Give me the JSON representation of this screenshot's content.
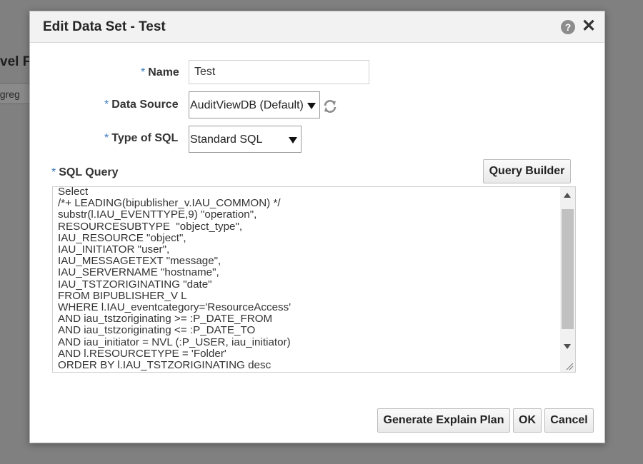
{
  "background": {
    "title_fragment": "vel Fo",
    "tab_fragment": "ggreg"
  },
  "dialog": {
    "title": "Edit Data Set - Test",
    "help_icon": "?",
    "close_icon": "✕"
  },
  "form": {
    "required_marker": "*",
    "name_label": "Name",
    "name_value": "Test",
    "datasource_label": "Data Source",
    "datasource_value": "AuditViewDB (Default)",
    "sqltype_label": "Type of SQL",
    "sqltype_value": "Standard SQL",
    "sqlquery_label": "SQL Query",
    "query_builder_label": "Query Builder"
  },
  "sql_lines": [
    "Select",
    "/*+ LEADING(bipublisher_v.IAU_COMMON) */",
    "substr(l.IAU_EVENTTYPE,9) \"operation\",",
    "RESOURCESUBTYPE  \"object_type\",",
    "IAU_RESOURCE \"object\",",
    "IAU_INITIATOR \"user\",",
    "IAU_MESSAGETEXT \"message\",",
    "IAU_SERVERNAME \"hostname\",",
    "IAU_TSTZORIGINATING \"date\"",
    "FROM BIPUBLISHER_V L",
    "WHERE l.IAU_eventcategory='ResourceAccess'",
    "AND iau_tstzoriginating >= :P_DATE_FROM",
    "AND iau_tstzoriginating <= :P_DATE_TO",
    "AND iau_initiator = NVL (:P_USER, iau_initiator)",
    "AND l.RESOURCETYPE = 'Folder'",
    "ORDER BY l.IAU_TSTZORIGINATING desc"
  ],
  "footer": {
    "explain_label": "Generate Explain Plan",
    "ok_label": "OK",
    "cancel_label": "Cancel"
  },
  "colors": {
    "required_marker": "#3b7bbf",
    "overlay": "#808080"
  },
  "icons": {
    "help": "help-icon",
    "close": "close-icon",
    "refresh": "refresh-icon",
    "dropdown": "chevron-down-icon"
  }
}
